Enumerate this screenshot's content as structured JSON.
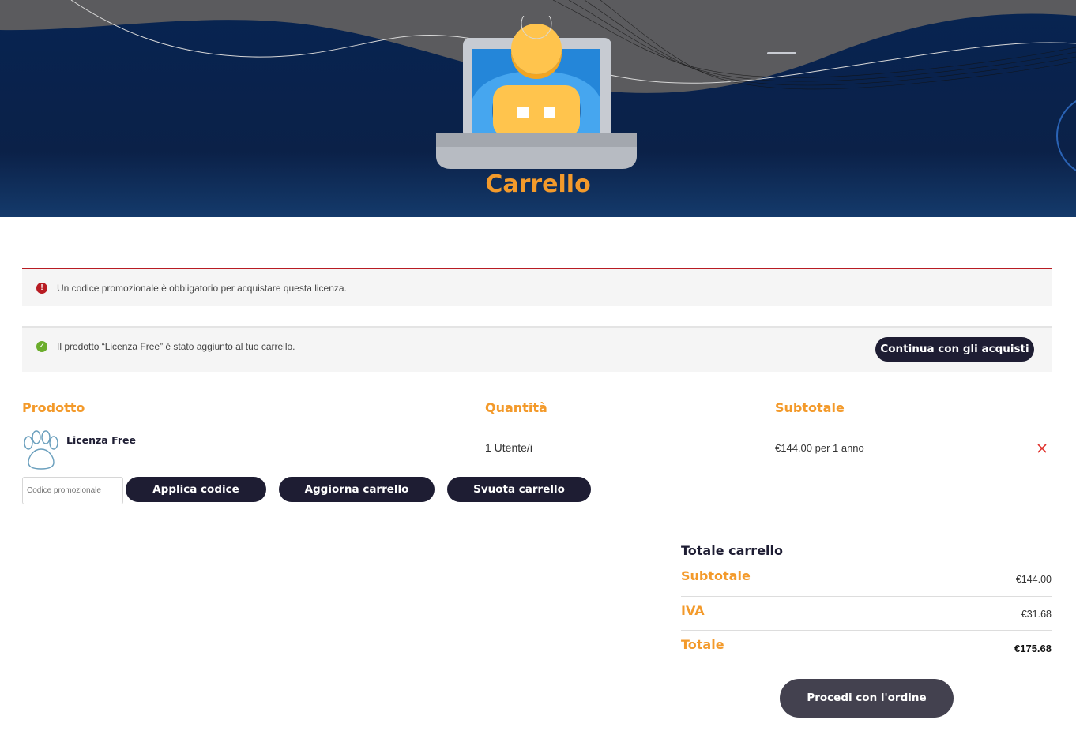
{
  "page": {
    "title": "Carrello"
  },
  "notices": {
    "error": {
      "icon": "error-circle-icon",
      "message": "Un codice promozionale è obbligatorio per acquistare questa licenza."
    },
    "success": {
      "icon": "check-circle-icon",
      "message": "Il prodotto “Licenza Free” è stato aggiunto al tuo carrello.",
      "button_label": "Continua con gli acquisti"
    }
  },
  "cart_table": {
    "headers": [
      "Prodotto",
      "Quantità",
      "Subtotale"
    ],
    "rows": [
      {
        "thumbnail": "paw-icon",
        "product": "Licenza Free",
        "quantity": "1 Utente/i",
        "subtotal": "€144.00 per 1 anno",
        "remove": "remove-icon"
      }
    ]
  },
  "actions": {
    "coupon_placeholder": "Codice promozionale",
    "apply_label": "Applica codice",
    "update_label": "Aggiorna carrello",
    "empty_label": "Svuota carrello"
  },
  "totals": {
    "title": "Totale carrello",
    "rows": [
      {
        "label": "Subtotale",
        "value": "€144.00"
      },
      {
        "label": "IVA",
        "value": "€31.68"
      },
      {
        "label": "Totale",
        "value": "€175.68"
      }
    ],
    "checkout_label": "Procedi con l'ordine"
  },
  "colors": {
    "accent": "#f39a2b",
    "dark_button": "#1e1d33",
    "error": "#b81c23",
    "success": "#6bad2c",
    "hero_navy": "#0d2450",
    "hero_gray": "#5b5b5e"
  }
}
